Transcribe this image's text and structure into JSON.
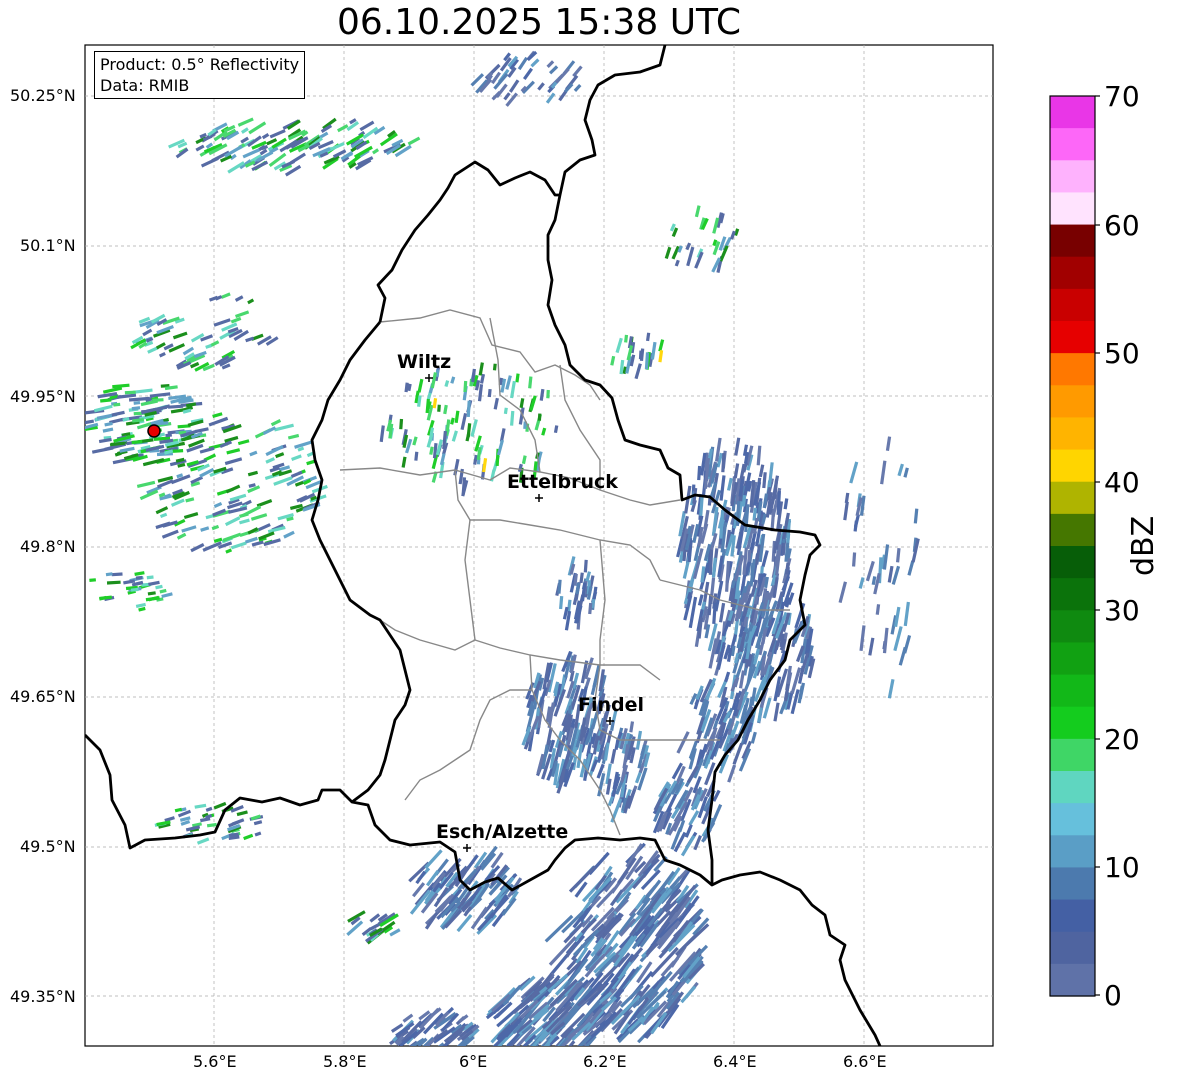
{
  "title": "06.10.2025 15:38 UTC",
  "info": {
    "product": "Product: 0.5° Reflectivity",
    "data": "Data: RMIB"
  },
  "lat_ticks": [
    "50.25°N",
    "50.1°N",
    "49.95°N",
    "49.8°N",
    "49.65°N",
    "49.5°N",
    "49.35°N"
  ],
  "lon_ticks": [
    "5.6°E",
    "5.8°E",
    "6°E",
    "6.2°E",
    "6.4°E",
    "6.6°E"
  ],
  "cities": [
    {
      "name": "Wiltz"
    },
    {
      "name": "Ettelbruck"
    },
    {
      "name": "Findel"
    },
    {
      "name": "Esch/Alzette"
    }
  ],
  "colorbar": {
    "unit": "dBZ",
    "ticks": [
      "70",
      "60",
      "50",
      "40",
      "30",
      "20",
      "10",
      "0"
    ],
    "colors": [
      "#e936e7",
      "#fd67f8",
      "#feb2fd",
      "#ffe3fe",
      "#780000",
      "#a10000",
      "#c90000",
      "#e60000",
      "#ff7800",
      "#ff9a00",
      "#ffb400",
      "#ffd500",
      "#afb400",
      "#457700",
      "#075e08",
      "#0b730b",
      "#0f8a10",
      "#11a112",
      "#12b818",
      "#14cc1e",
      "#3fd666",
      "#5fd6c0",
      "#66c0dc",
      "#5a9ec6",
      "#4c7aae",
      "#4460a4",
      "#4f64a0",
      "#5f72a8"
    ]
  },
  "colors": {
    "weak_echo": "#4f64a0",
    "moderate_echo": "#5a9ec6",
    "green_echo": "#14cc1e",
    "teal_echo": "#5fd6c0",
    "yellow_echo": "#ffd500",
    "radar_site": "#e60000"
  }
}
